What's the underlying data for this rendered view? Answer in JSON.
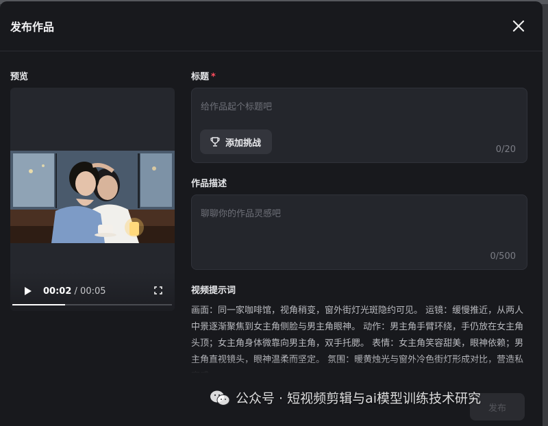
{
  "modal": {
    "title": "发布作品",
    "preview_label": "预览",
    "title_field": {
      "label": "标题",
      "required_mark": "*",
      "placeholder": "给作品起个标题吧",
      "challenge_button": "添加挑战",
      "counter": "0/20"
    },
    "description_field": {
      "label": "作品描述",
      "placeholder": "聊聊你的作品灵感吧",
      "counter": "0/500"
    },
    "prompt_section": {
      "label": "视频提示词",
      "text": "画面：同一家咖啡馆，视角稍变，窗外街灯光斑隐约可见。 运镜：缓慢推近，从两人中景逐渐聚焦到女主角侧脸与男主角眼神。 动作：男主角手臂环绕，手仍放在女主角头顶；女主角身体微靠向男主角，双手托腮。 表情：女主角笑容甜美，眼神依赖；男主角直视镜头，眼神温柔而坚定。 氛围：暖黄烛光与窗外冷色街灯形成对比，营造私密感。"
    },
    "video": {
      "current_time": "00:02",
      "separator": " / ",
      "duration": "00:05",
      "progress": 0.33
    },
    "publish_label": "发布"
  },
  "watermark": {
    "text": "公众号 · 短视频剪辑与ai模型训练技术研究"
  },
  "icons": [
    "close-icon",
    "play-icon",
    "fullscreen-icon",
    "trophy-icon",
    "wechat-icon"
  ],
  "colors": {
    "modal_bg": "#18191d",
    "field_bg": "#24262c",
    "required": "#ff4d5e"
  }
}
